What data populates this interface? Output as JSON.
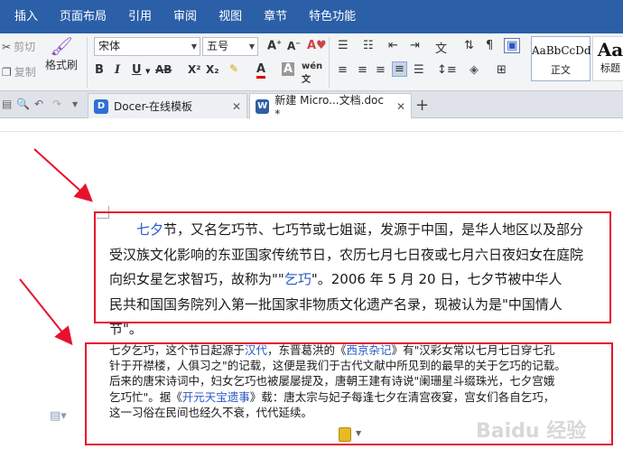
{
  "menu": {
    "items": [
      "插入",
      "页面布局",
      "引用",
      "审阅",
      "视图",
      "章节",
      "特色功能"
    ]
  },
  "ribbon": {
    "cut_label": "剪切",
    "copy_label": "复制",
    "format_painter_label": "格式刷",
    "font_name": "宋体",
    "font_size": "五号",
    "styles": [
      {
        "sample": "AaBbCcDd",
        "name": "正文"
      },
      {
        "sample": "Aa",
        "name": "标题"
      }
    ]
  },
  "tabs": {
    "tab1_title": "Docer-在线模板",
    "tab2_title": "新建 Micro...文档.doc *"
  },
  "document": {
    "para1": {
      "line1_link": "七夕",
      "line1_rest": "节，又名乞巧节、七巧节或七姐诞，发源于中国，是华人地区以及部分",
      "line2": "受汉族文化影响的东亚国家传统节日，农历七月七日夜或七月六日夜妇女在庭院",
      "line3_pre": "向织女星乞求智巧，故称为\"\"",
      "line3_link": "乞巧",
      "line3_post": "\"。2006 年 5 月 20 日，七夕节被中华人",
      "line4": "民共和国国务院列入第一批国家非物质文化遗产名录，现被认为是\"中国情人",
      "line5": "节\"。"
    },
    "para2": {
      "l1_a": "七夕乞巧，这个节日起源于",
      "l1_link1": "汉代",
      "l1_b": "，东晋葛洪的《",
      "l1_link2": "西京杂记",
      "l1_c": "》有\"汉彩女常以七月七日穿七孔",
      "l2": "针于开襟楼，人俱习之\"的记载，这便是我们于古代文献中所见到的最早的关于乞巧的记载。",
      "l3": "后来的唐宋诗词中，妇女乞巧也被屡屡提及，唐朝王建有诗说\"阑珊星斗缀珠光，七夕宫娥",
      "l4_a": "乞巧忙\"。据《",
      "l4_link": "开元天宝遗事",
      "l4_b": "》载：唐太宗与妃子每逢七夕在清宫夜宴，宫女们各自乞巧，",
      "l5": "这一习俗在民间也经久不衰，代代延续。"
    },
    "watermark": "Baidu 经验"
  },
  "colors": {
    "menubar": "#2b5fa8",
    "annotation_red": "#e8112d",
    "link_blue": "#2a58c4"
  }
}
